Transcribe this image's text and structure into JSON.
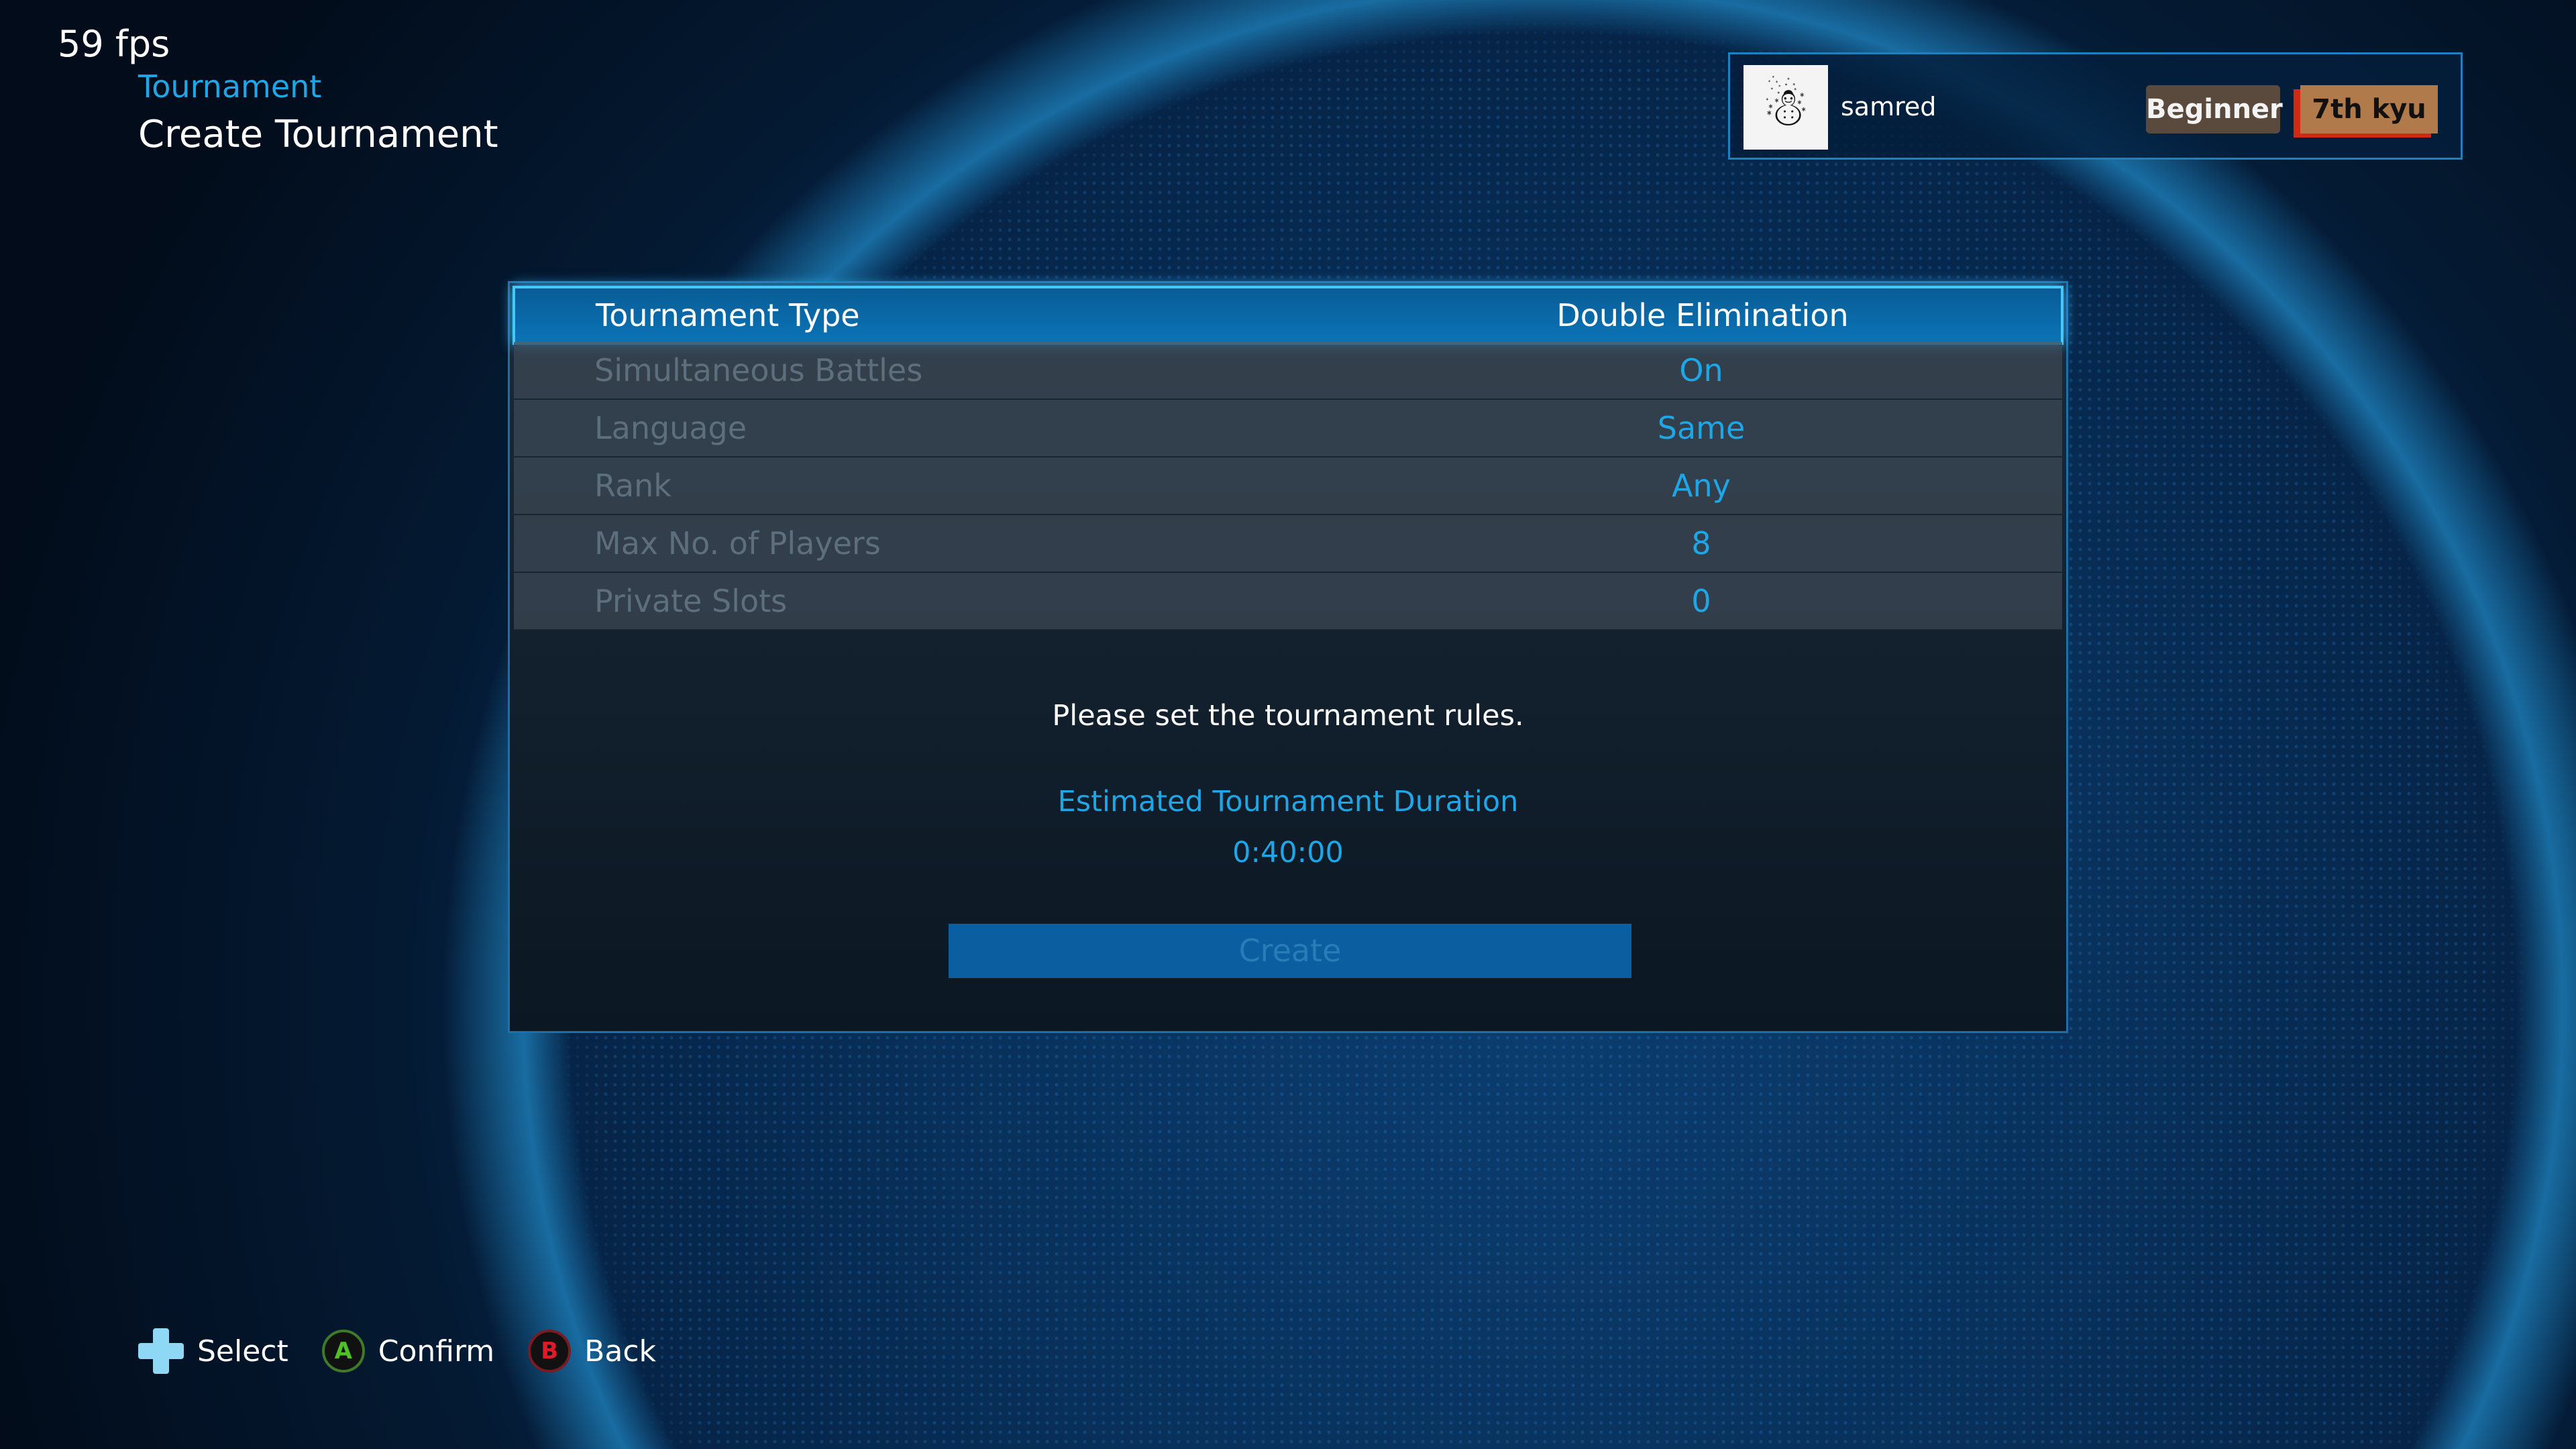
{
  "overlay": {
    "fps": "59 fps"
  },
  "header": {
    "breadcrumb": "Tournament",
    "title": "Create Tournament"
  },
  "profile": {
    "username": "samred",
    "rank_label": "Beginner",
    "rank": "7th kyu"
  },
  "settings": [
    {
      "label": "Tournament Type",
      "value": "Double Elimination",
      "selected": true
    },
    {
      "label": "Simultaneous Battles",
      "value": "On"
    },
    {
      "label": "Language",
      "value": "Same"
    },
    {
      "label": "Rank",
      "value": "Any"
    },
    {
      "label": "Max No. of Players",
      "value": "8"
    },
    {
      "label": "Private Slots",
      "value": "0"
    }
  ],
  "info": {
    "message": "Please set the tournament rules.",
    "duration_label": "Estimated Tournament Duration",
    "duration": "0:40:00"
  },
  "create_label": "Create",
  "hints": {
    "select": "Select",
    "a": "A",
    "confirm": "Confirm",
    "b": "B",
    "back": "Back"
  },
  "colors": {
    "accent": "#1ea6e6",
    "a_button": "#4fbf2a",
    "b_button": "#e01a2a"
  }
}
